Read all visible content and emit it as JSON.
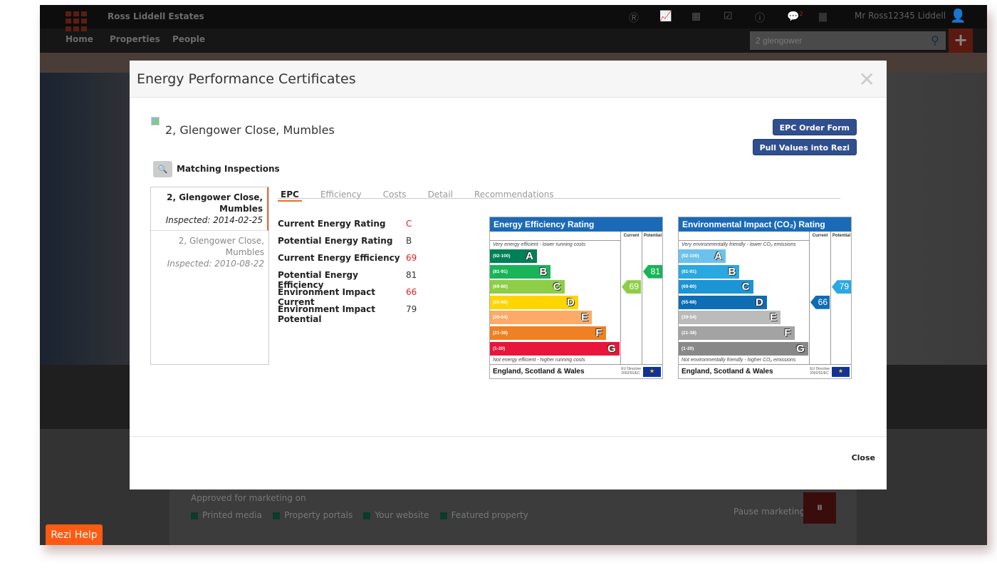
{
  "app": {
    "brand": "Ross Liddell Estates",
    "nav": [
      "Home",
      "Properties",
      "People"
    ],
    "user": "Mr Ross12345 Liddell",
    "search_value": "2 glengower",
    "notification_count": "2",
    "icons": [
      "r-icon",
      "chart-icon",
      "calendar-icon",
      "checkbox-icon",
      "alert-icon",
      "chat-icon",
      "briefcase-icon"
    ]
  },
  "background": {
    "approved_label": "Approved for marketing on",
    "channels": [
      "Printed media",
      "Property portals",
      "Your website",
      "Featured property"
    ],
    "pause_label": "Pause marketing",
    "help_label": "Rezi Help"
  },
  "modal": {
    "title": "Energy Performance Certificates",
    "address": "2, Glengower Close, Mumbles",
    "order_button": "EPC Order Form",
    "pull_button": "Pull Values into Rezi",
    "matching_label": "Matching Inspections",
    "inspections": [
      {
        "address": "2, Glengower Close, Mumbles",
        "inspected": "Inspected: 2014-02-25",
        "selected": true
      },
      {
        "address": "2, Glengower Close, Mumbles",
        "inspected": "Inspected: 2010-08-22",
        "selected": false
      }
    ],
    "tabs": [
      "EPC",
      "Efficiency",
      "Costs",
      "Detail",
      "Recommendations"
    ],
    "rows": [
      {
        "label": "Current Energy Rating",
        "value": "C",
        "highlight": true
      },
      {
        "label": "Potential Energy Rating",
        "value": "B",
        "highlight": false
      },
      {
        "label": "Current Energy Efficiency",
        "value": "69",
        "highlight": true
      },
      {
        "label": "Potential Energy Efficiency",
        "value": "81",
        "highlight": false
      },
      {
        "label": "Environment Impact Current",
        "value": "66",
        "highlight": true
      },
      {
        "label": "Environment Impact Potential",
        "value": "79",
        "highlight": false
      }
    ],
    "close_label": "Close"
  },
  "epc_charts": [
    {
      "title": "Energy Efficiency Rating",
      "col_current": "Current",
      "col_potential": "Potential",
      "top_note": "Very energy efficient - lower running costs",
      "bottom_note": "Not energy efficient - higher running costs",
      "footer": "England, Scotland & Wales",
      "eu1": "EU Directive",
      "eu2": "2002/91/EC",
      "bands": [
        {
          "range": "(92-100)",
          "letter": "A",
          "color": "#008054"
        },
        {
          "range": "(81-91)",
          "letter": "B",
          "color": "#19b459"
        },
        {
          "range": "(69-80)",
          "letter": "C",
          "color": "#8dce46"
        },
        {
          "range": "(55-68)",
          "letter": "D",
          "color": "#ffd500"
        },
        {
          "range": "(39-54)",
          "letter": "E",
          "color": "#fcaa65"
        },
        {
          "range": "(21-38)",
          "letter": "F",
          "color": "#ef8023"
        },
        {
          "range": "(1-20)",
          "letter": "G",
          "color": "#e9153b"
        }
      ],
      "current": 69,
      "current_band": "C",
      "current_color": "#8dce46",
      "potential": 81,
      "potential_band": "B",
      "potential_color": "#19b459"
    },
    {
      "title": "Environmental Impact (CO₂) Rating",
      "col_current": "Current",
      "col_potential": "Potential",
      "top_note": "Very environmentally friendly - lower CO₂ emissions",
      "bottom_note": "Not environmentally friendly - higher CO₂ emissions",
      "footer": "England, Scotland & Wales",
      "eu1": "EU Directive",
      "eu2": "2002/91/EC",
      "bands": [
        {
          "range": "(92-100)",
          "letter": "A",
          "color": "#6cc2ec"
        },
        {
          "range": "(81-91)",
          "letter": "B",
          "color": "#2aa8e0"
        },
        {
          "range": "(69-80)",
          "letter": "C",
          "color": "#1d94d3"
        },
        {
          "range": "(55-68)",
          "letter": "D",
          "color": "#0f6db3"
        },
        {
          "range": "(39-54)",
          "letter": "E",
          "color": "#bbbbbb"
        },
        {
          "range": "(21-38)",
          "letter": "F",
          "color": "#a3a3a3"
        },
        {
          "range": "(1-20)",
          "letter": "G",
          "color": "#888888"
        }
      ],
      "current": 66,
      "current_band": "D",
      "current_color": "#0f6db3",
      "potential": 79,
      "potential_band": "C",
      "potential_color": "#2aa8e0"
    }
  ]
}
